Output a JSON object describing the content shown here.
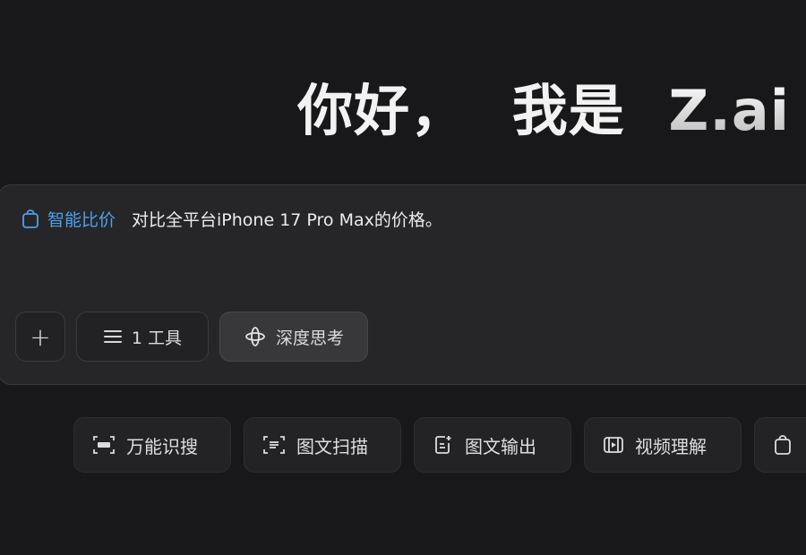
{
  "greeting": {
    "hello": "你好，",
    "intro": "我是",
    "brand": "Z.ai"
  },
  "composer": {
    "tag_label": "智能比价",
    "tag_icon": "shopping-bag-icon",
    "prompt_text": "对比全平台iPhone 17 Pro Max的价格。",
    "add_icon": "+",
    "tools_label": "1 工具",
    "think_label": "深度思考"
  },
  "chips": [
    {
      "label": "万能识搜",
      "icon": "ai-scan-icon"
    },
    {
      "label": "图文扫描",
      "icon": "doc-scan-icon"
    },
    {
      "label": "图文输出",
      "icon": "doc-export-icon"
    },
    {
      "label": "视频理解",
      "icon": "video-icon"
    },
    {
      "label": "",
      "icon": "shopping-bag-icon"
    }
  ],
  "colors": {
    "background": "#18181a",
    "accent": "#4ea0ec"
  }
}
